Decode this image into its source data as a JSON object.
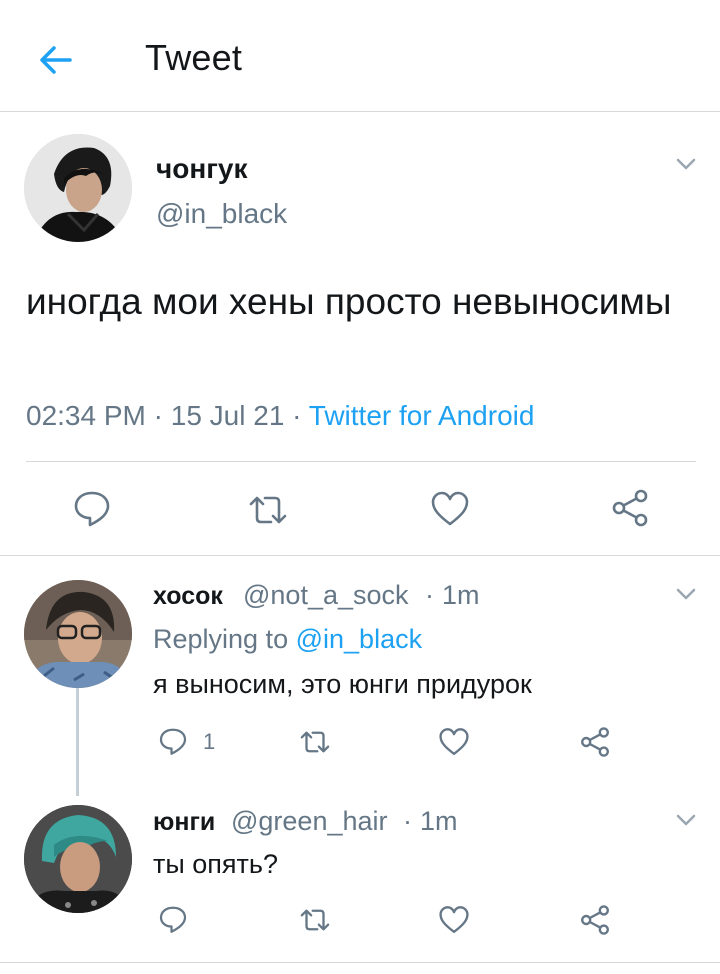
{
  "header": {
    "title": "Tweet",
    "back_icon": "arrow-left-icon"
  },
  "colors": {
    "accent": "#1da1f2",
    "secondary_text": "#657786",
    "primary_text": "#14171a",
    "divider": "#d6d9dc"
  },
  "main_tweet": {
    "display_name": "чонгук",
    "handle": "@in_black",
    "text": "иногда мои хены просто невыносимы",
    "time": "02:34 PM",
    "date": "15 Jul 21",
    "separator": "·",
    "source": "Twitter for Android",
    "actions": [
      "reply-icon",
      "retweet-icon",
      "like-icon",
      "share-icon"
    ]
  },
  "replies": [
    {
      "display_name": "хосок",
      "handle": "@not_a_sock",
      "separator": "·",
      "age": "1m",
      "replying_prefix": "Replying to",
      "replying_to": "@in_black",
      "text": "я выносим, это юнги придурок",
      "reply_count": "1"
    },
    {
      "display_name": "юнги",
      "handle": "@green_hair",
      "separator": "·",
      "age": "1m",
      "text": "ты опять?"
    }
  ]
}
